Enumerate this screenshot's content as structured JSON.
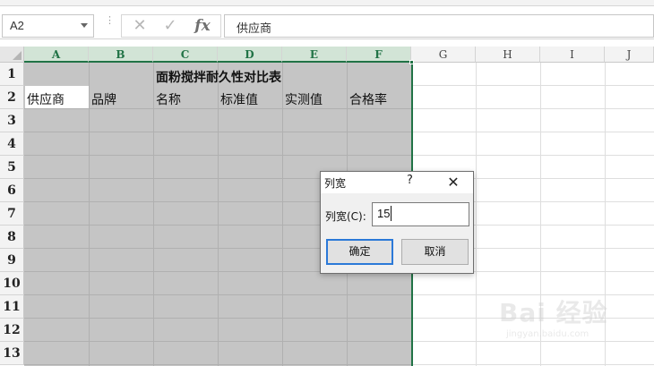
{
  "formula_bar": {
    "name_box": "A2",
    "cancel_icon": "✕",
    "enter_icon": "✓",
    "fx_label": "fx",
    "content": "供应商"
  },
  "columns": [
    "A",
    "B",
    "C",
    "D",
    "E",
    "F",
    "G",
    "H",
    "I",
    "J"
  ],
  "selected_columns": [
    "A",
    "B",
    "C",
    "D",
    "E",
    "F"
  ],
  "rows": [
    "1",
    "2",
    "3",
    "4",
    "5",
    "6",
    "7",
    "8",
    "9",
    "10",
    "11",
    "12",
    "13"
  ],
  "sheet": {
    "title": "面粉搅拌耐久性对比表",
    "headers": [
      "供应商",
      "品牌",
      "名称",
      "标准值",
      "实测值",
      "合格率"
    ]
  },
  "dialog": {
    "title": "列宽",
    "help": "?",
    "close_icon": "✕",
    "label": "列宽(C):",
    "value": "15",
    "ok": "确定",
    "cancel": "取消"
  },
  "watermark": {
    "brand": "Bai 经验",
    "url": "jingyan.baidu.com"
  },
  "colors": {
    "selection": "#c5c5c5",
    "accent": "#217346",
    "ok_border": "#2b79d8"
  }
}
